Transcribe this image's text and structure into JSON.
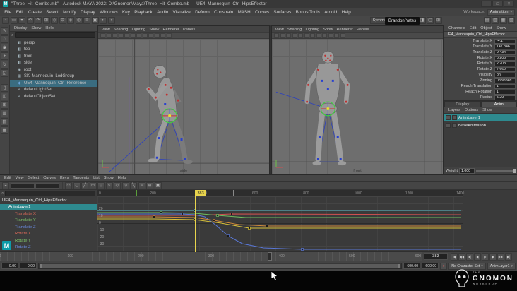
{
  "window": {
    "title": "\"Three_Hit_Combo.mb\" - Autodesk MAYA 2022: D:\\Gnomon\\Maya\\Three_Hit_Combo.mb --- UE4_Mannequin_Ctrl_HipsEffector",
    "controls": [
      "─",
      "□",
      "×"
    ]
  },
  "menubar": {
    "items": [
      "File",
      "Edit",
      "Create",
      "Select",
      "Modify",
      "Display",
      "Windows",
      "Key",
      "Playback",
      "Audio",
      "Visualize",
      "Deform",
      "Constrain",
      "MASH",
      "Curves",
      "Surfaces",
      "Bonus Tools",
      "Arnold",
      "Help"
    ],
    "workspace_label": "Workspace:",
    "workspace_value": "Animation"
  },
  "statusline": {
    "symmetry": "Symmetry: Off",
    "user_overlay": "Brandon Yates",
    "icons_left": [
      {
        "name": "new-scene-icon",
        "glyph": "▫"
      },
      {
        "name": "open-scene-icon",
        "glyph": "▭"
      },
      {
        "name": "save-scene-icon",
        "glyph": "▾"
      },
      {
        "name": "undo-icon",
        "glyph": "↶"
      },
      {
        "name": "redo-icon",
        "glyph": "↷"
      },
      {
        "name": "snap-grid-icon",
        "glyph": "⊞"
      },
      {
        "name": "snap-curve-icon",
        "glyph": "◇"
      },
      {
        "name": "snap-point-icon",
        "glyph": "⊙"
      },
      {
        "name": "snap-plane-icon",
        "glyph": "◈"
      },
      {
        "name": "make-live-icon",
        "glyph": "◎"
      },
      {
        "name": "construction-history-icon",
        "glyph": "≡"
      },
      {
        "name": "render-view-icon",
        "glyph": "▣"
      },
      {
        "name": "render-frame-icon",
        "glyph": "◐"
      },
      {
        "name": "ipr-render-icon",
        "glyph": "◑"
      }
    ],
    "icons_mid": [
      {
        "name": "object-mode-icon",
        "glyph": "◧"
      },
      {
        "name": "component-mode-icon",
        "glyph": "◨"
      },
      {
        "name": "highlight-selection-icon",
        "glyph": "▢"
      },
      {
        "name": "grid-toggle-icon",
        "glyph": "⊞"
      }
    ],
    "icons_right": [
      {
        "name": "outliner-toggle-icon",
        "glyph": "▤"
      },
      {
        "name": "attribute-editor-toggle-icon",
        "glyph": "▥"
      },
      {
        "name": "tool-settings-toggle-icon",
        "glyph": "▦"
      },
      {
        "name": "channel-box-toggle-icon",
        "glyph": "▧"
      }
    ]
  },
  "toolbox": {
    "tools": [
      {
        "name": "select-tool-icon",
        "glyph": "↖"
      },
      {
        "name": "lasso-tool-icon",
        "glyph": "◌"
      },
      {
        "name": "paint-select-tool-icon",
        "glyph": "◉"
      },
      {
        "name": "move-tool-icon",
        "glyph": "+"
      },
      {
        "name": "rotate-tool-icon",
        "glyph": "↻"
      },
      {
        "name": "scale-tool-icon",
        "glyph": "◱"
      }
    ],
    "layouts": [
      {
        "name": "layout-single-icon",
        "glyph": "▯"
      },
      {
        "name": "layout-two-side-icon",
        "glyph": "◫"
      },
      {
        "name": "layout-four-icon",
        "glyph": "⊞"
      },
      {
        "name": "layout-outliner-persp-icon",
        "glyph": "▥"
      },
      {
        "name": "layout-graph-persp-icon",
        "glyph": "▤"
      },
      {
        "name": "layout-hypershade-icon",
        "glyph": "▦"
      }
    ]
  },
  "outliner": {
    "menus": [
      "Display",
      "Show",
      "Help"
    ],
    "items": [
      {
        "label": "persp",
        "icon": "camera"
      },
      {
        "label": "top",
        "icon": "camera"
      },
      {
        "label": "front",
        "icon": "camera"
      },
      {
        "label": "side",
        "icon": "camera"
      },
      {
        "label": "root",
        "icon": "joint"
      },
      {
        "label": "SK_Mannequin_LodGroup",
        "icon": "group"
      },
      {
        "label": "UE4_Mannequin_Ctrl_Reference",
        "icon": "reference",
        "selected": true
      },
      {
        "label": "defaultLightSet",
        "icon": "set"
      },
      {
        "label": "defaultObjectSet",
        "icon": "set"
      }
    ]
  },
  "viewports": {
    "menus": [
      "View",
      "Shading",
      "Lighting",
      "Show",
      "Renderer",
      "Panels"
    ],
    "toolbar_icons": [
      {
        "name": "lock-camera-icon"
      },
      {
        "name": "camera-attributes-icon"
      },
      {
        "name": "bookmark-icon"
      },
      {
        "name": "image-plane-icon"
      },
      {
        "name": "2d-pan-zoom-icon"
      },
      {
        "name": "isolate-select-icon"
      },
      {
        "name": "wireframe-icon"
      },
      {
        "name": "shaded-icon"
      },
      {
        "name": "textured-icon"
      },
      {
        "name": "lighting-icon"
      },
      {
        "name": "shadows-icon"
      },
      {
        "name": "ao-icon"
      }
    ],
    "left_camera": "side",
    "right_camera": "front"
  },
  "channel_box": {
    "menus": [
      "Channels",
      "Edit",
      "Object",
      "Show"
    ],
    "node": "UE4_Mannequin_Ctrl_HipsEffector",
    "attributes": [
      {
        "name": "Translate X",
        "value": "-4.17"
      },
      {
        "name": "Translate Y",
        "value": "147.346"
      },
      {
        "name": "Translate Z",
        "value": "9.434"
      },
      {
        "name": "Rotate X",
        "value": "0.206"
      },
      {
        "name": "Rotate Y",
        "value": "2.203"
      },
      {
        "name": "Rotate Z",
        "value": "7.662"
      },
      {
        "name": "Visibility",
        "value": "on"
      },
      {
        "name": "Pinning",
        "value": "unpinned"
      },
      {
        "name": "Reach Translation",
        "value": "1"
      },
      {
        "name": "Reach Rotation",
        "value": "1"
      },
      {
        "name": "Radius",
        "value": "5.29"
      }
    ]
  },
  "layer_editor": {
    "tabs": [
      {
        "label": "Display",
        "selected": false
      },
      {
        "label": "Anim",
        "selected": true
      }
    ],
    "menus": [
      "Layers",
      "Options",
      "Show"
    ],
    "layers": [
      {
        "name": "AnimLayer1",
        "selected": true
      },
      {
        "name": "BaseAnimation",
        "selected": false
      }
    ],
    "weight_label": "Weight",
    "weight_value": "1.000"
  },
  "graph_editor": {
    "menus": [
      "Edit",
      "View",
      "Select",
      "Curves",
      "Keys",
      "Tangents",
      "List",
      "Show",
      "Help"
    ],
    "toolbar_icons": [
      {
        "name": "spline-tangent-icon",
        "glyph": "◠"
      },
      {
        "name": "clamped-tangent-icon",
        "glyph": "◡"
      },
      {
        "name": "linear-tangent-icon",
        "glyph": "╱"
      },
      {
        "name": "flat-tangent-icon",
        "glyph": "▭"
      },
      {
        "name": "step-tangent-icon",
        "glyph": "⊡"
      },
      {
        "name": "plateau-tangent-icon",
        "glyph": "~"
      },
      {
        "name": "buffer-curve-icon",
        "glyph": "◇"
      },
      {
        "name": "swap-buffer-icon",
        "glyph": "⊙"
      },
      {
        "name": "break-tangent-icon",
        "glyph": "╲"
      },
      {
        "name": "unify-tangent-icon",
        "glyph": "≡"
      },
      {
        "name": "frame-all-icon",
        "glyph": "⊞"
      },
      {
        "name": "frame-playback-icon",
        "glyph": "▣"
      }
    ],
    "channels": [
      {
        "label": "UE4_Mannequin_Ctrl_HipsEffector",
        "color": "#e2e2e2",
        "indent": 0
      },
      {
        "label": "AnimLayer1",
        "color": "#ffffff",
        "indent": 1,
        "selected": true
      },
      {
        "label": "Translate X",
        "color": "#e06a5a",
        "indent": 2
      },
      {
        "label": "Translate Y",
        "color": "#7ec46a",
        "indent": 2
      },
      {
        "label": "Translate Z",
        "color": "#6a8ae0",
        "indent": 2
      },
      {
        "label": "Rotate X",
        "color": "#e06a5a",
        "indent": 2
      },
      {
        "label": "Rotate Y",
        "color": "#7ec46a",
        "indent": 2
      },
      {
        "label": "Rotate Z",
        "color": "#6a8ae0",
        "indent": 2
      }
    ],
    "value_labels": [
      "20",
      "10",
      "0",
      "-10",
      "-20",
      "-30"
    ],
    "frame_labels": [
      "0",
      "200",
      "400",
      "600",
      "800",
      "1000",
      "1200",
      "1400"
    ],
    "frame_range": [
      0,
      1430
    ],
    "current_frame": 383,
    "markers": [
      {
        "frame": 150,
        "color": "#5a9e3a"
      },
      {
        "frame": 530,
        "color": "#8a8a8a"
      }
    ],
    "curves": [
      {
        "name": "Translate X",
        "color": "#d05050",
        "points": [
          [
            0,
            27
          ],
          [
            138,
            27
          ],
          [
            190,
            25
          ],
          [
            515,
            26
          ]
        ],
        "keys": [
          [
            190,
            25
          ]
        ]
      },
      {
        "name": "Translate Y",
        "color": "#6fbf5f",
        "points": [
          [
            0,
            23
          ],
          [
            90,
            23
          ],
          [
            138,
            24
          ],
          [
            170,
            27
          ],
          [
            210,
            30
          ],
          [
            515,
            30
          ]
        ],
        "keys": [
          [
            90,
            23
          ],
          [
            170,
            27
          ]
        ]
      },
      {
        "name": "Translate Z",
        "color": "#5a78d8",
        "points": [
          [
            0,
            25
          ],
          [
            120,
            25
          ],
          [
            138,
            26
          ],
          [
            152,
            29
          ],
          [
            168,
            41
          ],
          [
            185,
            56
          ],
          [
            205,
            67
          ],
          [
            235,
            73
          ],
          [
            290,
            75
          ],
          [
            515,
            75
          ]
        ],
        "keys": [
          [
            120,
            25
          ],
          [
            185,
            56
          ],
          [
            290,
            75
          ]
        ]
      },
      {
        "name": "Rotate X",
        "color": "#d08a3a",
        "points": [
          [
            0,
            29
          ],
          [
            80,
            29
          ],
          [
            138,
            30
          ],
          [
            165,
            34
          ],
          [
            200,
            40
          ],
          [
            240,
            42
          ],
          [
            515,
            42
          ]
        ],
        "keys": [
          [
            80,
            29
          ],
          [
            165,
            34
          ],
          [
            240,
            42
          ]
        ]
      },
      {
        "name": "Rotate Y",
        "color": "#d8c23a",
        "points": [
          [
            0,
            32
          ],
          [
            80,
            32
          ],
          [
            138,
            33
          ],
          [
            175,
            38
          ],
          [
            215,
            45
          ],
          [
            515,
            45
          ]
        ],
        "keys": [
          [
            138,
            33
          ],
          [
            215,
            45
          ]
        ]
      },
      {
        "name": "Rotate Z",
        "color": "#58b8c8",
        "points": [
          [
            0,
            20
          ],
          [
            138,
            20
          ],
          [
            515,
            20
          ]
        ],
        "keys": [
          [
            138,
            20
          ]
        ]
      }
    ]
  },
  "time_slider": {
    "range": [
      0,
      600
    ],
    "current": 383,
    "current_display": "383",
    "labels": [
      "0",
      "100",
      "200",
      "300",
      "400",
      "500",
      "600"
    ]
  },
  "transport": {
    "buttons": [
      {
        "name": "go-to-start-button",
        "glyph": "|◀"
      },
      {
        "name": "step-back-key-button",
        "glyph": "◀◀"
      },
      {
        "name": "step-back-frame-button",
        "glyph": "◀|"
      },
      {
        "name": "play-backward-button",
        "glyph": "◀"
      },
      {
        "name": "play-forward-button",
        "glyph": "▶"
      },
      {
        "name": "step-forward-frame-button",
        "glyph": "|▶"
      },
      {
        "name": "step-forward-key-button",
        "glyph": "▶▶"
      },
      {
        "name": "go-to-end-button",
        "glyph": "▶|"
      }
    ]
  },
  "range_slider": {
    "start": "0.00",
    "playback_start": "0.00",
    "playback_end": "600.00",
    "end": "600.00"
  },
  "playback_options": {
    "character_set": "No Character Set",
    "anim_layer": "AnimLayer1"
  },
  "branding": {
    "maya_initial": "M",
    "logo_the": "THE",
    "logo_name": "GNOMON",
    "logo_workshop": "WORKSHOP"
  }
}
